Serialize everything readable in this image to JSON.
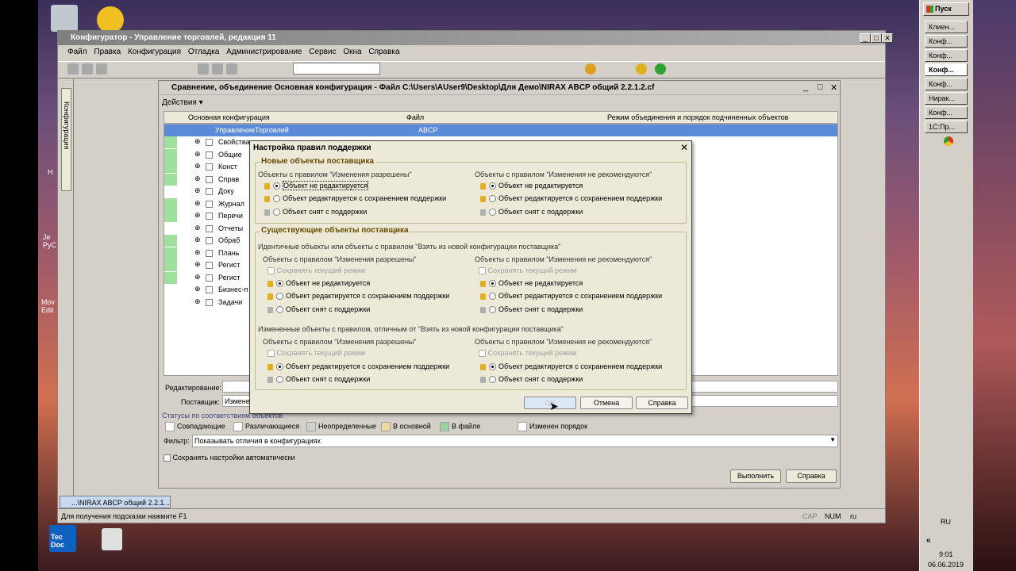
{
  "main_window": {
    "title": "Конфигуратор - Управление торговлей, редакция 11",
    "menu": [
      "Файл",
      "Правка",
      "Конфигурация",
      "Отладка",
      "Администрирование",
      "Сервис",
      "Окна",
      "Справка"
    ],
    "sidebar_tab": "Конфигурация",
    "status_hint": "Для получения подсказки нажмите F1",
    "status_indicators": [
      "CAP",
      "NUM",
      "ru"
    ],
    "doc_tab": "...\\NIRAX ABCP общий 2.2.1..."
  },
  "compare_window": {
    "title": "Сравнение, объединение Основная конфигурация - Файл C:\\Users\\AUser9\\Desktop\\Для Демо\\NIRAX ABCP общий 2.2.1.2.cf",
    "actions_label": "Действия",
    "col_main": "Основная конфигурация",
    "col_file": "Файл",
    "col_mode": "Режим объединения и порядок подчиненных объектов",
    "root_main": "УправлениеТорговлей",
    "root_file": "ABCP",
    "tree_items": [
      "Свойства",
      "Общие",
      "Конст",
      "Справ",
      "Доку",
      "Журнал",
      "Перечи",
      "Отчеты",
      "Обраб",
      "Плань",
      "Регист",
      "Регист",
      "Бизнес-п",
      "Задачи"
    ],
    "editing_label": "Редактирование:",
    "supplier_label": "Поставщик:",
    "supplier_value": "Изменен",
    "statuses_label": "Статусы по соответствиям объектов",
    "legend": [
      "Совпадающие",
      "Различающиеся",
      "Неопределенные",
      "В основной",
      "В файле",
      "Изменен порядок"
    ],
    "filter_label": "Фильтр:",
    "filter_value": "Показывать отличия в конфигурациях",
    "save_settings_label": "Сохранять настройки автоматически",
    "run_button": "Выполнить",
    "help_button": "Справка"
  },
  "dialog": {
    "title": "Настройка правил поддержки",
    "new_group": "Новые объекты поставщика",
    "rule_allowed": "Объекты с правилом \"Изменения разрешены\"",
    "rule_not_recommended": "Объекты с правилом \"Изменения не рекомендуются\"",
    "opt_not_edited": "Объект не редактируется",
    "opt_edited_keep": "Объект редактируется с сохранением поддержки",
    "opt_removed": "Объект снят с поддержки",
    "existing_group": "Существующие объекты поставщика",
    "identical_label": "Идентичные объекты или объекты с правилом \"Взять из новой конфигурации поставщика\"",
    "changed_label": "Измененные объекты с правилом, отличным от \"Взять из новой конфигурации поставщика\"",
    "keep_mode": "Сохранять текущий режим",
    "ok_button": "OK",
    "cancel_button": "Отмена",
    "help_button": "Справка"
  },
  "taskbar": {
    "start": "Пуск",
    "items": [
      "Клиен...",
      "Конф...",
      "Конф...",
      "Конф...",
      "Конф...",
      "Нирак...",
      "Конф...",
      "1С:Пр..."
    ],
    "lang": "RU",
    "time": "9:01",
    "date": "06.06.2019"
  },
  "desktop": {
    "icon_left_labels": [
      "Н",
      "Je PyC",
      "Mov Edit"
    ],
    "tecdoc_label": "Tec Doc"
  }
}
